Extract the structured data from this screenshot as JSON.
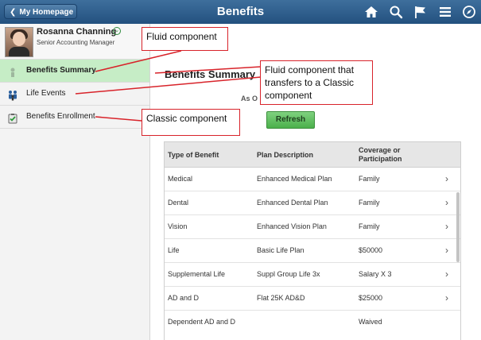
{
  "header": {
    "home_label": "My Homepage",
    "title": "Benefits",
    "icons": [
      "home-icon",
      "search-icon",
      "flag-icon",
      "menu-icon",
      "navbar-icon"
    ],
    "bar_color": "#2f5f8f"
  },
  "profile": {
    "name": "Rosanna Channing",
    "job_title": "Senior Accounting Manager"
  },
  "nav": {
    "items": [
      {
        "label": "Benefits Summary",
        "icon": "benefits-summary-icon",
        "selected": true
      },
      {
        "label": "Life Events",
        "icon": "family-icon",
        "selected": false
      },
      {
        "label": "Benefits Enrollment",
        "icon": "clipboard-check-icon",
        "selected": false
      }
    ],
    "selected_color": "#c6edc6"
  },
  "main": {
    "title": "Benefits Summary",
    "as_of": "As O",
    "refresh_label": "Refresh",
    "columns": [
      "Type of Benefit",
      "Plan Description",
      "Coverage or Participation"
    ],
    "rows": [
      {
        "type": "Medical",
        "plan": "Enhanced Medical Plan",
        "coverage": "Family",
        "chevron": "›"
      },
      {
        "type": "Dental",
        "plan": "Enhanced Dental Plan",
        "coverage": "Family",
        "chevron": "›"
      },
      {
        "type": "Vision",
        "plan": "Enhanced Vision Plan",
        "coverage": "Family",
        "chevron": "›"
      },
      {
        "type": "Life",
        "plan": "Basic Life Plan",
        "coverage": "$50000",
        "chevron": "›"
      },
      {
        "type": "Supplemental Life",
        "plan": "Suppl Group Life 3x",
        "coverage": "Salary X 3",
        "chevron": "›"
      },
      {
        "type": "AD and D",
        "plan": "Flat 25K AD&D",
        "coverage": "$25000",
        "chevron": "›"
      },
      {
        "type": "Dependent AD and D",
        "plan": "",
        "coverage": "Waived",
        "chevron": ""
      }
    ]
  },
  "callouts": {
    "fluid": "Fluid component",
    "fluid_classic": "Fluid component that transfers to a Classic component",
    "classic": "Classic component",
    "color": "#d8232a"
  }
}
